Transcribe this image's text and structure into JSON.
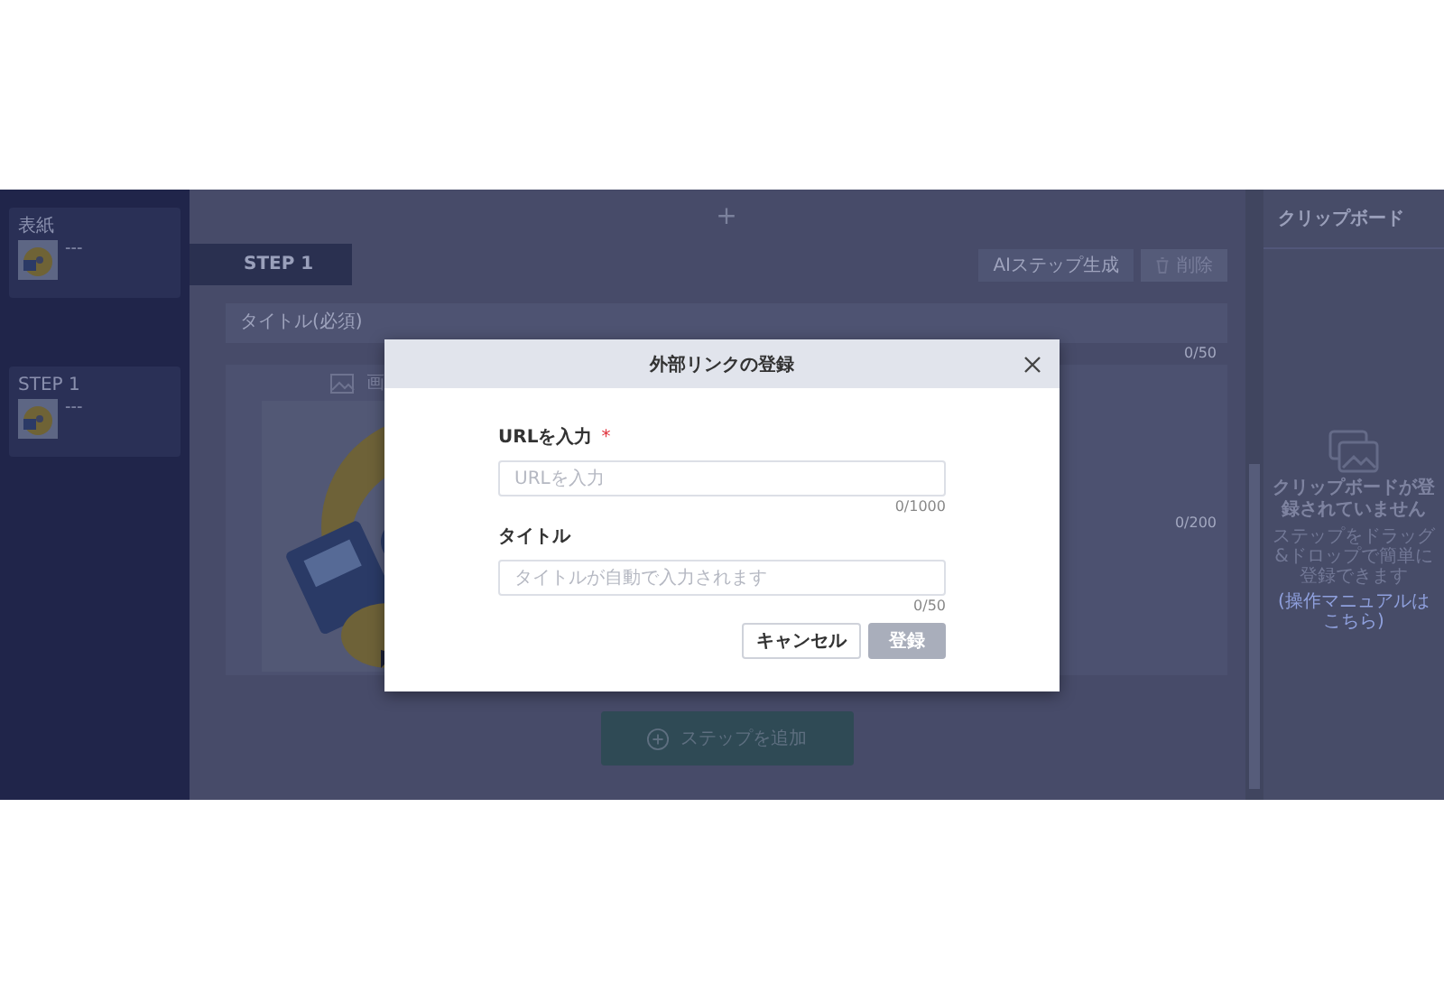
{
  "sidebar": {
    "items": [
      {
        "label": "表紙",
        "caption": "---"
      },
      {
        "label": "STEP 1",
        "caption": "---"
      }
    ]
  },
  "editor": {
    "add_above": "+",
    "step_tab": "STEP 1",
    "actions": [
      "AIステップ生成",
      "削除"
    ],
    "title_field": {
      "placeholder": "タイトル(必須)",
      "counter": "0/50"
    },
    "media_tab": "画",
    "description_counter": "0/200",
    "add_step_button": "ステップを追加"
  },
  "clipboard": {
    "title": "クリップボード",
    "empty_title": "クリップボードが登録されていません",
    "empty_hint": "ステップをドラッグ&ドロップで簡単に登録できます",
    "manual_link": "(操作マニュアルはこちら)"
  },
  "dialog": {
    "title": "外部リンクの登録",
    "fields": [
      {
        "label": "URLを入力",
        "required_mark": "*",
        "placeholder": "URLを入力",
        "counter": "0/1000"
      },
      {
        "label": "タイトル",
        "placeholder": "タイトルが自動で入力されます",
        "counter": "0/50"
      }
    ],
    "buttons": [
      {
        "label": "キャンセル",
        "kind": "secondary",
        "disabled": false
      },
      {
        "label": "登録",
        "kind": "primary",
        "disabled": true
      }
    ]
  }
}
